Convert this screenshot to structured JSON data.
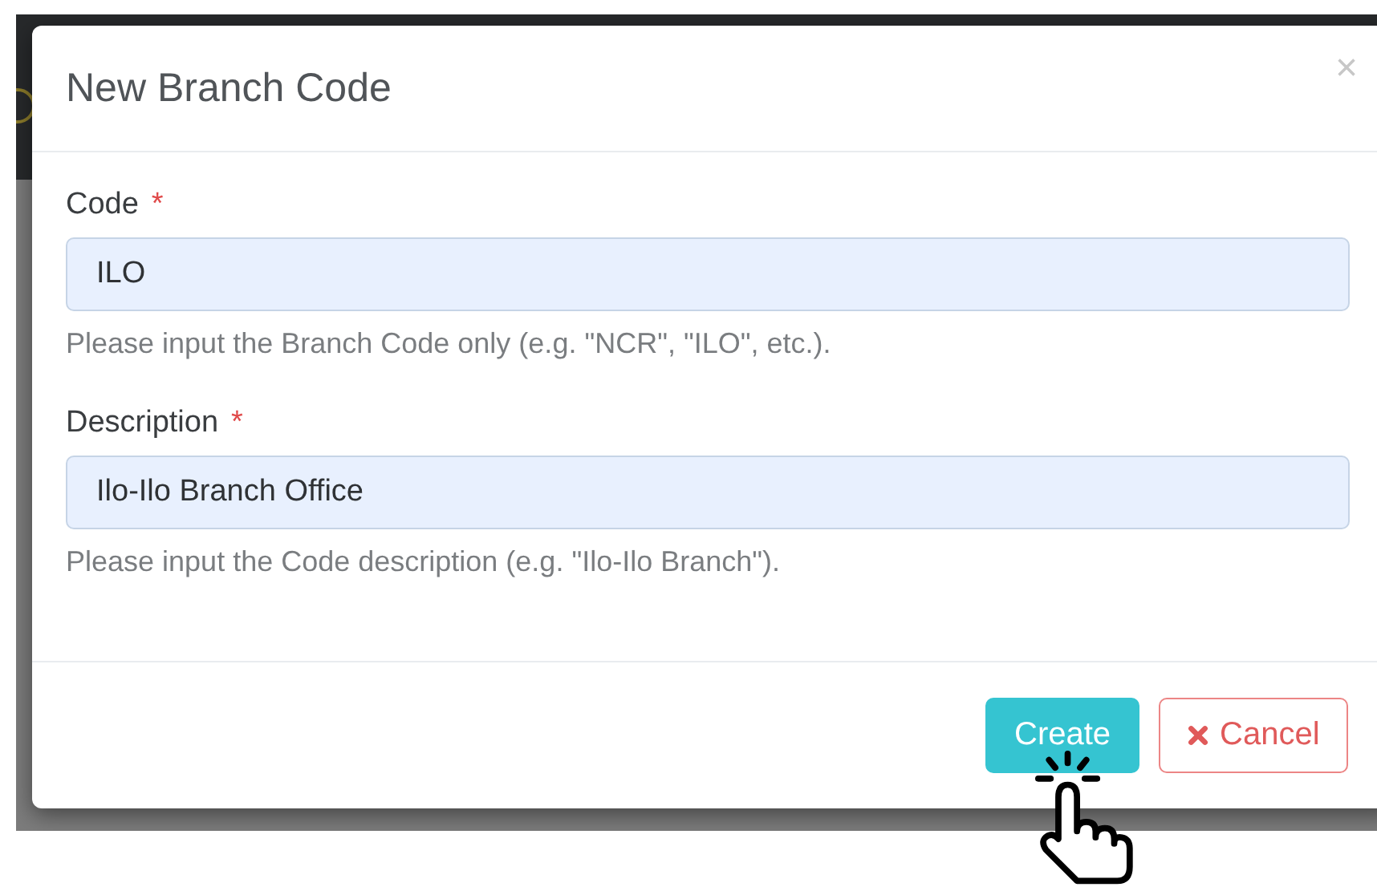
{
  "dialog": {
    "title": "New Branch Code",
    "close": "×",
    "fields": [
      {
        "label": "Code",
        "required_mark": "*",
        "value": "ILO",
        "help": "Please input the Branch Code only (e.g. \"NCR\", \"ILO\", etc.)."
      },
      {
        "label": "Description",
        "required_mark": "*",
        "value": "Ilo-Ilo Branch Office",
        "help": "Please input the Code description (e.g. \"Ilo-Ilo Branch\")."
      }
    ],
    "buttons": [
      {
        "kind": "primary",
        "label": "Create"
      },
      {
        "kind": "cancel",
        "label": "Cancel"
      }
    ]
  }
}
